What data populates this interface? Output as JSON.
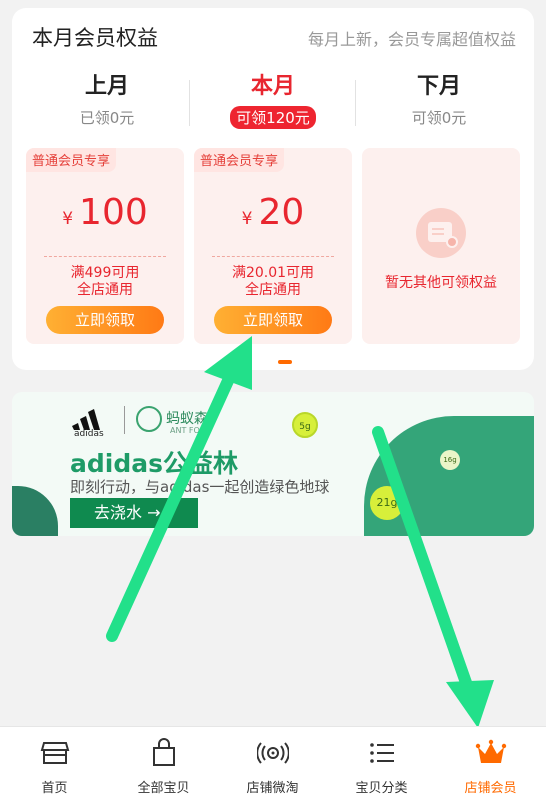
{
  "benefits": {
    "title": "本月会员权益",
    "subtitle": "每月上新，会员专属超值权益",
    "months": [
      {
        "name": "上月",
        "status": "已领0元"
      },
      {
        "name": "本月",
        "status": "可领120元"
      },
      {
        "name": "下月",
        "status": "可领0元"
      }
    ],
    "coupons": [
      {
        "tag": "普通会员专享",
        "currency": "¥",
        "value": "100",
        "cond1": "满499可用",
        "cond2": "全店通用",
        "button": "立即领取"
      },
      {
        "tag": "普通会员专享",
        "currency": "¥",
        "value": "20",
        "cond1": "满20.01可用",
        "cond2": "全店通用",
        "button": "立即领取"
      }
    ],
    "empty_text": "暂无其他可领权益",
    "accent": "#e8262f"
  },
  "banner": {
    "brand": "adidas",
    "partner": "蚂蚁森",
    "partner_sub": "ANT FO",
    "title": "adidas公益林",
    "subtitle": "即刻行动，与adidas一起创造绿色地球",
    "button": "去浇水 →",
    "ball1": "5g",
    "ball2": "16g",
    "ball3": "21g"
  },
  "tabbar": {
    "items": [
      {
        "label": "首页",
        "icon": "storefront-icon"
      },
      {
        "label": "全部宝贝",
        "icon": "shopping-bag-icon"
      },
      {
        "label": "店铺微淘",
        "icon": "broadcast-icon"
      },
      {
        "label": "宝贝分类",
        "icon": "list-icon"
      },
      {
        "label": "店铺会员",
        "icon": "crown-icon"
      }
    ],
    "active_color": "#ff6a00"
  }
}
